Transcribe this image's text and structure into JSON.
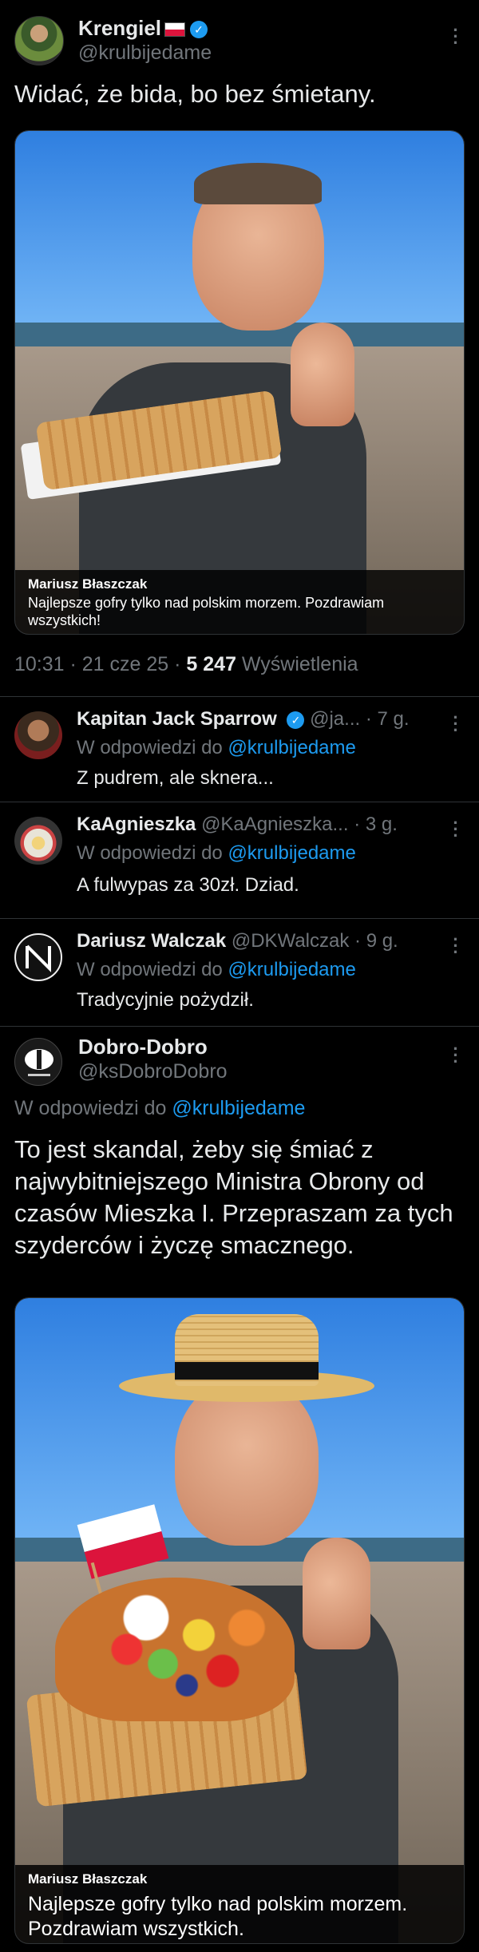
{
  "main_post": {
    "name": "Krengiel",
    "handle": "@krulbijedame",
    "text": "Widać, że bida, bo bez śmietany.",
    "image_caption_name": "Mariusz Błaszczak",
    "image_caption_text": "Najlepsze gofry tylko nad polskim morzem. Pozdrawiam wszystkich!",
    "time": "10:31 · 21 cze 25 · ",
    "views_count": "5 247",
    "views_label": " Wyświetlenia"
  },
  "replies": [
    {
      "name": "Kapitan Jack Sparrow",
      "handle": "@ja...",
      "age": "· 7 g.",
      "reply_to_prefix": "W odpowiedzi do ",
      "reply_to": "@krulbijedame",
      "text": "Z pudrem, ale sknera..."
    },
    {
      "name": "KaAgnieszka",
      "handle": "@KaAgnieszka...",
      "age": "· 3 g.",
      "reply_to_prefix": "W odpowiedzi do ",
      "reply_to": "@krulbijedame",
      "text": "A fulwypas za 30zł. Dziad."
    },
    {
      "name": "Dariusz Walczak",
      "handle": "@DKWalczak",
      "age": "· 9 g.",
      "reply_to_prefix": "W odpowiedzi do ",
      "reply_to": "@krulbijedame",
      "text": "Tradycyjnie pożydził."
    }
  ],
  "focused_reply": {
    "name": "Dobro-Dobro",
    "handle": "@ksDobroDobro",
    "reply_to_prefix": "W odpowiedzi do ",
    "reply_to": "@krulbijedame",
    "text": "To jest skandal, żeby się śmiać z najwybitniejszego Ministra Obrony od czasów Mieszka I. Przepraszam za tych szyderców i życzę smacznego.",
    "image_caption_name": "Mariusz Błaszczak",
    "image_caption_text": "Najlepsze gofry tylko nad polskim morzem. Pozdrawiam wszystkich."
  },
  "icons": {
    "verified": "verified-badge-icon",
    "more": "more-options-icon",
    "flag": "poland-flag-icon"
  },
  "colors": {
    "background": "#000000",
    "text": "#e7e9ea",
    "muted": "#71767b",
    "link": "#1d9bf0",
    "divider": "#2f3336"
  }
}
